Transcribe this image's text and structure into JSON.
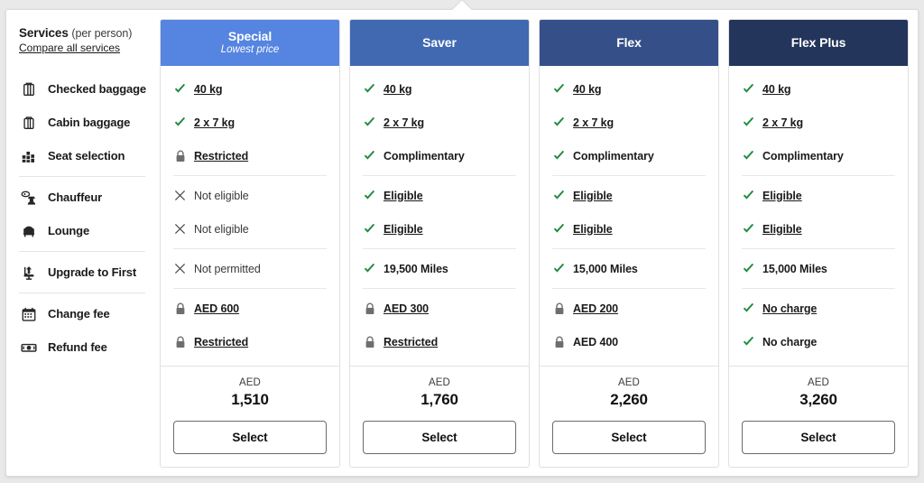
{
  "sidebar": {
    "title": "Services",
    "title_suffix": "(per person)",
    "compare_link": "Compare all services",
    "items": [
      {
        "label": "Checked baggage",
        "icon": "checked-baggage-icon",
        "sep_after": false
      },
      {
        "label": "Cabin baggage",
        "icon": "cabin-baggage-icon",
        "sep_after": false
      },
      {
        "label": "Seat selection",
        "icon": "seat-selection-icon",
        "sep_after": true
      },
      {
        "label": "Chauffeur",
        "icon": "chauffeur-icon",
        "sep_after": false
      },
      {
        "label": "Lounge",
        "icon": "lounge-icon",
        "sep_after": true
      },
      {
        "label": "Upgrade to First",
        "icon": "upgrade-icon",
        "sep_after": true
      },
      {
        "label": "Change fee",
        "icon": "calendar-icon",
        "sep_after": false
      },
      {
        "label": "Refund fee",
        "icon": "banknote-icon",
        "sep_after": false
      }
    ]
  },
  "colors": {
    "special": "#5585e0",
    "saver": "#4169b2",
    "flex": "#355089",
    "flex_plus": "#24355c",
    "check": "#1e8a3c",
    "lock": "#6e6e6e",
    "cross": "#4a4a4a"
  },
  "currency_label": "AED",
  "select_label": "Select",
  "columns": [
    {
      "name": "Special",
      "tagline": "Lowest price",
      "accent": "#5585e0",
      "features": [
        {
          "icon": "check-icon",
          "text": "40 kg",
          "underlined": true,
          "sep_after": false
        },
        {
          "icon": "check-icon",
          "text": "2 x 7 kg",
          "underlined": true,
          "sep_after": false
        },
        {
          "icon": "lock-icon",
          "text": "Restricted",
          "underlined": true,
          "sep_after": true
        },
        {
          "icon": "cross-icon",
          "text": "Not eligible",
          "underlined": false,
          "sep_after": false,
          "muted": true
        },
        {
          "icon": "cross-icon",
          "text": "Not eligible",
          "underlined": false,
          "sep_after": true,
          "muted": true
        },
        {
          "icon": "cross-icon",
          "text": "Not permitted",
          "underlined": false,
          "sep_after": true,
          "muted": true
        },
        {
          "icon": "lock-icon",
          "text": "AED 600",
          "underlined": true,
          "sep_after": false
        },
        {
          "icon": "lock-icon",
          "text": "Restricted",
          "underlined": true,
          "sep_after": false
        }
      ],
      "price": "1,510"
    },
    {
      "name": "Saver",
      "tagline": "",
      "accent": "#4169b2",
      "features": [
        {
          "icon": "check-icon",
          "text": "40 kg",
          "underlined": true,
          "sep_after": false
        },
        {
          "icon": "check-icon",
          "text": "2 x 7 kg",
          "underlined": true,
          "sep_after": false
        },
        {
          "icon": "check-icon",
          "text": "Complimentary",
          "underlined": false,
          "sep_after": true
        },
        {
          "icon": "check-icon",
          "text": "Eligible",
          "underlined": true,
          "sep_after": false
        },
        {
          "icon": "check-icon",
          "text": "Eligible",
          "underlined": true,
          "sep_after": true
        },
        {
          "icon": "check-icon",
          "text": "19,500 Miles",
          "underlined": false,
          "sep_after": true
        },
        {
          "icon": "lock-icon",
          "text": "AED 300",
          "underlined": true,
          "sep_after": false
        },
        {
          "icon": "lock-icon",
          "text": "Restricted",
          "underlined": true,
          "sep_after": false
        }
      ],
      "price": "1,760"
    },
    {
      "name": "Flex",
      "tagline": "",
      "accent": "#355089",
      "features": [
        {
          "icon": "check-icon",
          "text": "40 kg",
          "underlined": true,
          "sep_after": false
        },
        {
          "icon": "check-icon",
          "text": "2 x 7 kg",
          "underlined": true,
          "sep_after": false
        },
        {
          "icon": "check-icon",
          "text": "Complimentary",
          "underlined": false,
          "sep_after": true
        },
        {
          "icon": "check-icon",
          "text": "Eligible",
          "underlined": true,
          "sep_after": false
        },
        {
          "icon": "check-icon",
          "text": "Eligible",
          "underlined": true,
          "sep_after": true
        },
        {
          "icon": "check-icon",
          "text": "15,000 Miles",
          "underlined": false,
          "sep_after": true
        },
        {
          "icon": "lock-icon",
          "text": "AED 200",
          "underlined": true,
          "sep_after": false
        },
        {
          "icon": "lock-icon",
          "text": "AED 400",
          "underlined": false,
          "sep_after": false
        }
      ],
      "price": "2,260"
    },
    {
      "name": "Flex Plus",
      "tagline": "",
      "accent": "#24355c",
      "features": [
        {
          "icon": "check-icon",
          "text": "40 kg",
          "underlined": true,
          "sep_after": false
        },
        {
          "icon": "check-icon",
          "text": "2 x 7 kg",
          "underlined": true,
          "sep_after": false
        },
        {
          "icon": "check-icon",
          "text": "Complimentary",
          "underlined": false,
          "sep_after": true
        },
        {
          "icon": "check-icon",
          "text": "Eligible",
          "underlined": true,
          "sep_after": false
        },
        {
          "icon": "check-icon",
          "text": "Eligible",
          "underlined": true,
          "sep_after": true
        },
        {
          "icon": "check-icon",
          "text": "15,000 Miles",
          "underlined": false,
          "sep_after": true
        },
        {
          "icon": "check-icon",
          "text": "No charge",
          "underlined": true,
          "sep_after": false
        },
        {
          "icon": "check-icon",
          "text": "No charge",
          "underlined": false,
          "sep_after": false
        }
      ],
      "price": "3,260"
    }
  ]
}
